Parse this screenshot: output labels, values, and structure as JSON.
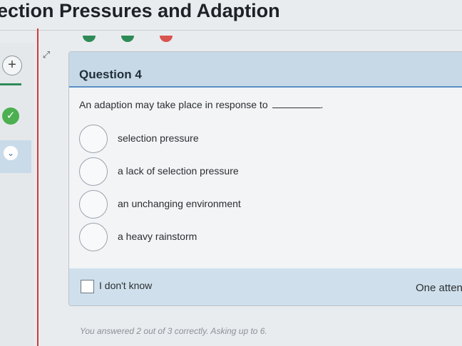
{
  "page": {
    "title": "ection Pressures and Adaption"
  },
  "progress": {
    "dots": [
      "correct",
      "correct",
      "incorrect"
    ]
  },
  "left_rail": {
    "add_icon": "plus-icon",
    "check_icon": "checkmark-icon",
    "chevron_icon": "chevron-down-icon",
    "expand_icon": "expand-icon"
  },
  "question": {
    "title": "Question 4",
    "prompt": "An adaption may take place in response to",
    "prompt_end": ".",
    "options": [
      {
        "label": "selection pressure"
      },
      {
        "label": "a lack of selection pressure"
      },
      {
        "label": "an unchanging environment"
      },
      {
        "label": "a heavy rainstorm"
      }
    ],
    "dont_know": "I don't know",
    "attempt_text": "One atten"
  },
  "status": {
    "text": "You answered 2 out of 3 correctly. Asking up to 6."
  },
  "colors": {
    "accent": "#5b8fc2",
    "correct": "#2e8b57",
    "incorrect": "#d9534f",
    "header": "#c7d9e7"
  }
}
